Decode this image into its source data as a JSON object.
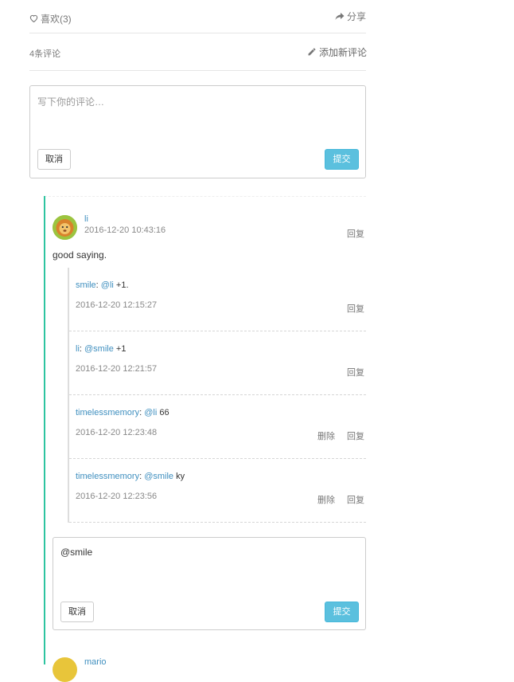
{
  "actions": {
    "like_label": "喜欢(3)",
    "share_label": "分享"
  },
  "comments_header": {
    "count_label": "4条评论",
    "add_label": "添加新评论"
  },
  "new_comment_form": {
    "placeholder": "写下你的评论…",
    "cancel_label": "取消",
    "submit_label": "提交"
  },
  "comment": {
    "author": "li",
    "timestamp": "2016-12-20 10:43:16",
    "reply_label": "回复",
    "body": "good saying."
  },
  "replies": [
    {
      "author": "smile",
      "mention": "@li",
      "text": "+1.",
      "timestamp": "2016-12-20 12:15:27",
      "reply_label": "回复"
    },
    {
      "author": "li",
      "mention": "@smile",
      "text": "+1",
      "timestamp": "2016-12-20 12:21:57",
      "reply_label": "回复"
    },
    {
      "author": "timelessmemory",
      "mention": "@li",
      "text": "66",
      "timestamp": "2016-12-20 12:23:48",
      "delete_label": "删除",
      "reply_label": "回复"
    },
    {
      "author": "timelessmemory",
      "mention": "@smile",
      "text": "ky",
      "timestamp": "2016-12-20 12:23:56",
      "delete_label": "删除",
      "reply_label": "回复"
    }
  ],
  "reply_form": {
    "value": "@smile",
    "cancel_label": "取消",
    "submit_label": "提交"
  },
  "next_comment": {
    "author": "mario"
  },
  "colors": {
    "link": "#3f8fbf",
    "accent_bar": "#2ec4a0",
    "primary_button": "#5bc0de"
  }
}
